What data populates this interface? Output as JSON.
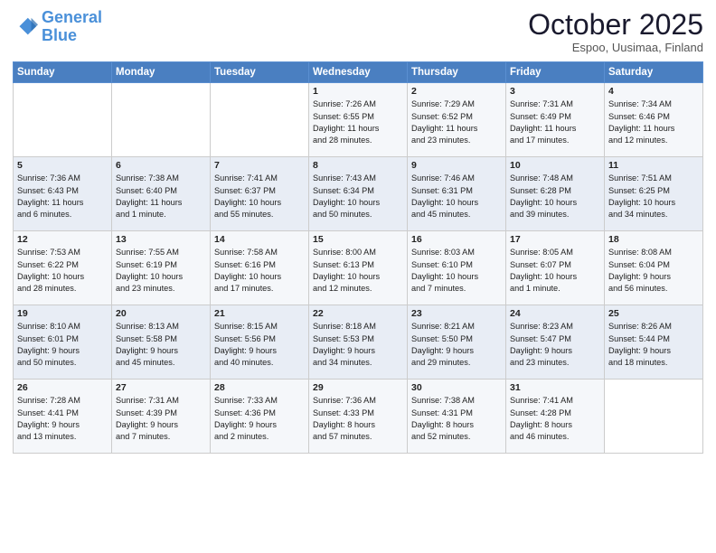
{
  "header": {
    "logo_line1": "General",
    "logo_line2": "Blue",
    "month": "October 2025",
    "location": "Espoo, Uusimaa, Finland"
  },
  "days_of_week": [
    "Sunday",
    "Monday",
    "Tuesday",
    "Wednesday",
    "Thursday",
    "Friday",
    "Saturday"
  ],
  "weeks": [
    [
      {
        "day": "",
        "info": ""
      },
      {
        "day": "",
        "info": ""
      },
      {
        "day": "",
        "info": ""
      },
      {
        "day": "1",
        "info": "Sunrise: 7:26 AM\nSunset: 6:55 PM\nDaylight: 11 hours\nand 28 minutes."
      },
      {
        "day": "2",
        "info": "Sunrise: 7:29 AM\nSunset: 6:52 PM\nDaylight: 11 hours\nand 23 minutes."
      },
      {
        "day": "3",
        "info": "Sunrise: 7:31 AM\nSunset: 6:49 PM\nDaylight: 11 hours\nand 17 minutes."
      },
      {
        "day": "4",
        "info": "Sunrise: 7:34 AM\nSunset: 6:46 PM\nDaylight: 11 hours\nand 12 minutes."
      }
    ],
    [
      {
        "day": "5",
        "info": "Sunrise: 7:36 AM\nSunset: 6:43 PM\nDaylight: 11 hours\nand 6 minutes."
      },
      {
        "day": "6",
        "info": "Sunrise: 7:38 AM\nSunset: 6:40 PM\nDaylight: 11 hours\nand 1 minute."
      },
      {
        "day": "7",
        "info": "Sunrise: 7:41 AM\nSunset: 6:37 PM\nDaylight: 10 hours\nand 55 minutes."
      },
      {
        "day": "8",
        "info": "Sunrise: 7:43 AM\nSunset: 6:34 PM\nDaylight: 10 hours\nand 50 minutes."
      },
      {
        "day": "9",
        "info": "Sunrise: 7:46 AM\nSunset: 6:31 PM\nDaylight: 10 hours\nand 45 minutes."
      },
      {
        "day": "10",
        "info": "Sunrise: 7:48 AM\nSunset: 6:28 PM\nDaylight: 10 hours\nand 39 minutes."
      },
      {
        "day": "11",
        "info": "Sunrise: 7:51 AM\nSunset: 6:25 PM\nDaylight: 10 hours\nand 34 minutes."
      }
    ],
    [
      {
        "day": "12",
        "info": "Sunrise: 7:53 AM\nSunset: 6:22 PM\nDaylight: 10 hours\nand 28 minutes."
      },
      {
        "day": "13",
        "info": "Sunrise: 7:55 AM\nSunset: 6:19 PM\nDaylight: 10 hours\nand 23 minutes."
      },
      {
        "day": "14",
        "info": "Sunrise: 7:58 AM\nSunset: 6:16 PM\nDaylight: 10 hours\nand 17 minutes."
      },
      {
        "day": "15",
        "info": "Sunrise: 8:00 AM\nSunset: 6:13 PM\nDaylight: 10 hours\nand 12 minutes."
      },
      {
        "day": "16",
        "info": "Sunrise: 8:03 AM\nSunset: 6:10 PM\nDaylight: 10 hours\nand 7 minutes."
      },
      {
        "day": "17",
        "info": "Sunrise: 8:05 AM\nSunset: 6:07 PM\nDaylight: 10 hours\nand 1 minute."
      },
      {
        "day": "18",
        "info": "Sunrise: 8:08 AM\nSunset: 6:04 PM\nDaylight: 9 hours\nand 56 minutes."
      }
    ],
    [
      {
        "day": "19",
        "info": "Sunrise: 8:10 AM\nSunset: 6:01 PM\nDaylight: 9 hours\nand 50 minutes."
      },
      {
        "day": "20",
        "info": "Sunrise: 8:13 AM\nSunset: 5:58 PM\nDaylight: 9 hours\nand 45 minutes."
      },
      {
        "day": "21",
        "info": "Sunrise: 8:15 AM\nSunset: 5:56 PM\nDaylight: 9 hours\nand 40 minutes."
      },
      {
        "day": "22",
        "info": "Sunrise: 8:18 AM\nSunset: 5:53 PM\nDaylight: 9 hours\nand 34 minutes."
      },
      {
        "day": "23",
        "info": "Sunrise: 8:21 AM\nSunset: 5:50 PM\nDaylight: 9 hours\nand 29 minutes."
      },
      {
        "day": "24",
        "info": "Sunrise: 8:23 AM\nSunset: 5:47 PM\nDaylight: 9 hours\nand 23 minutes."
      },
      {
        "day": "25",
        "info": "Sunrise: 8:26 AM\nSunset: 5:44 PM\nDaylight: 9 hours\nand 18 minutes."
      }
    ],
    [
      {
        "day": "26",
        "info": "Sunrise: 7:28 AM\nSunset: 4:41 PM\nDaylight: 9 hours\nand 13 minutes."
      },
      {
        "day": "27",
        "info": "Sunrise: 7:31 AM\nSunset: 4:39 PM\nDaylight: 9 hours\nand 7 minutes."
      },
      {
        "day": "28",
        "info": "Sunrise: 7:33 AM\nSunset: 4:36 PM\nDaylight: 9 hours\nand 2 minutes."
      },
      {
        "day": "29",
        "info": "Sunrise: 7:36 AM\nSunset: 4:33 PM\nDaylight: 8 hours\nand 57 minutes."
      },
      {
        "day": "30",
        "info": "Sunrise: 7:38 AM\nSunset: 4:31 PM\nDaylight: 8 hours\nand 52 minutes."
      },
      {
        "day": "31",
        "info": "Sunrise: 7:41 AM\nSunset: 4:28 PM\nDaylight: 8 hours\nand 46 minutes."
      },
      {
        "day": "",
        "info": ""
      }
    ]
  ]
}
